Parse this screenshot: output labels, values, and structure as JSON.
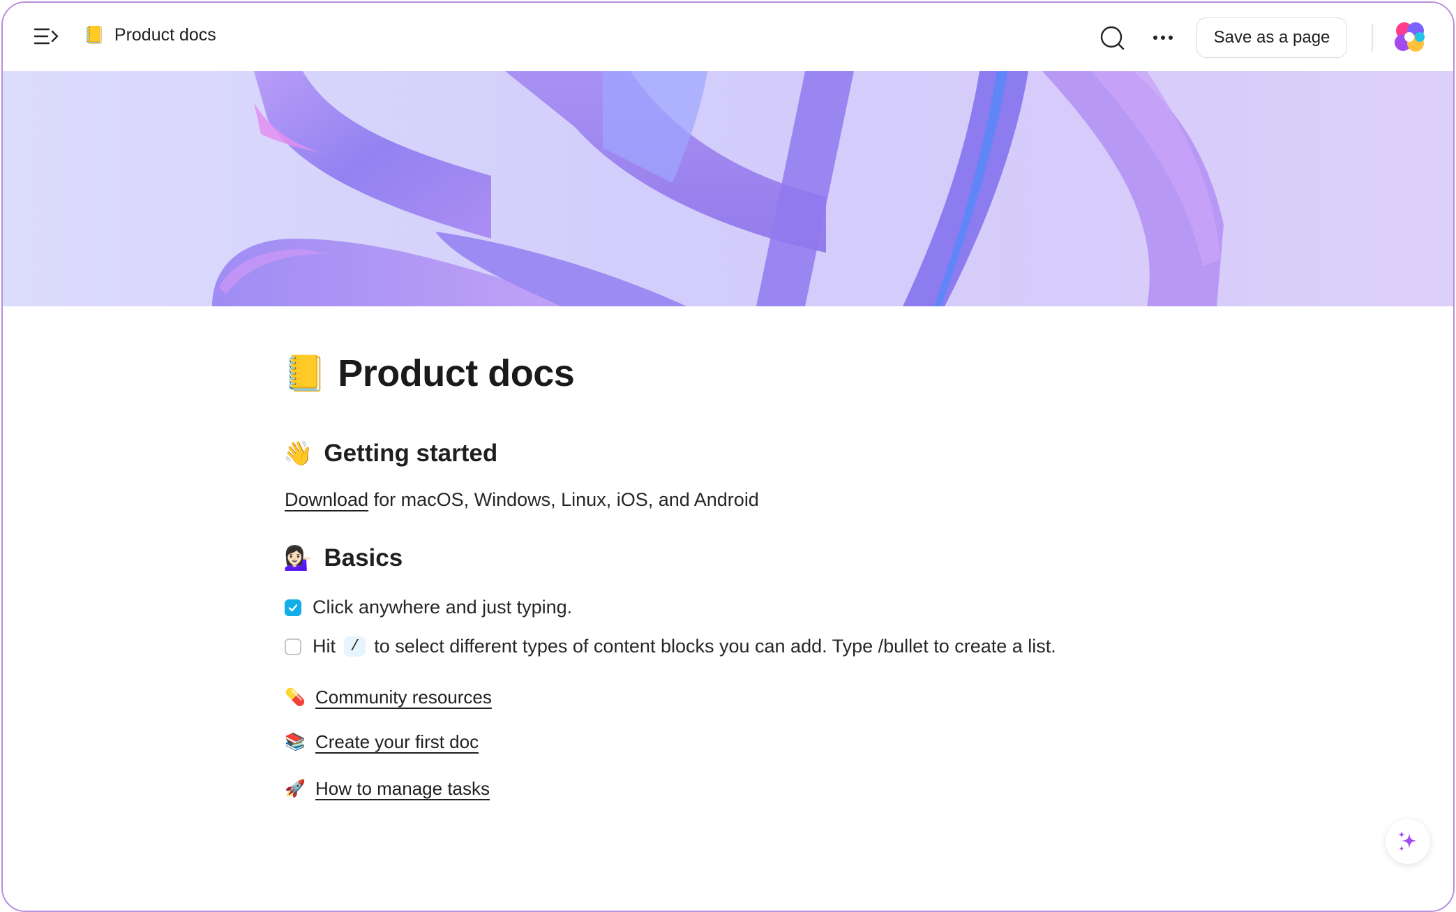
{
  "topbar": {
    "page_emoji": "📒",
    "page_name": "Product docs",
    "save_label": "Save as a page",
    "icons": {
      "menu": "sidebar-toggle-icon",
      "search": "search-icon",
      "more": "more-dots-icon",
      "logo": "app-logo-icon"
    }
  },
  "page": {
    "emoji": "📒",
    "title": "Product docs"
  },
  "getting_started": {
    "emoji": "👋",
    "heading": "Getting started",
    "download_link": "Download",
    "download_rest": " for macOS, Windows, Linux, iOS, and Android"
  },
  "basics": {
    "emoji": "💁🏻‍♀️",
    "heading": "Basics",
    "todos": [
      {
        "checked": true,
        "text": "Click anywhere and just typing."
      },
      {
        "checked": false,
        "prefix": "Hit",
        "code": "/",
        "suffix": "to select different types of content blocks you can add. Type /bullet to create a list."
      }
    ]
  },
  "links": [
    {
      "emoji": "💊",
      "label": "Community resources"
    },
    {
      "emoji": "📚",
      "label": "Create your first doc"
    },
    {
      "emoji": "🚀",
      "label": "How to manage tasks"
    }
  ],
  "colors": {
    "accent_checkbox": "#12aee8",
    "frame_border": "#b88fdc",
    "ai_sparkle": "#a24bf0"
  }
}
